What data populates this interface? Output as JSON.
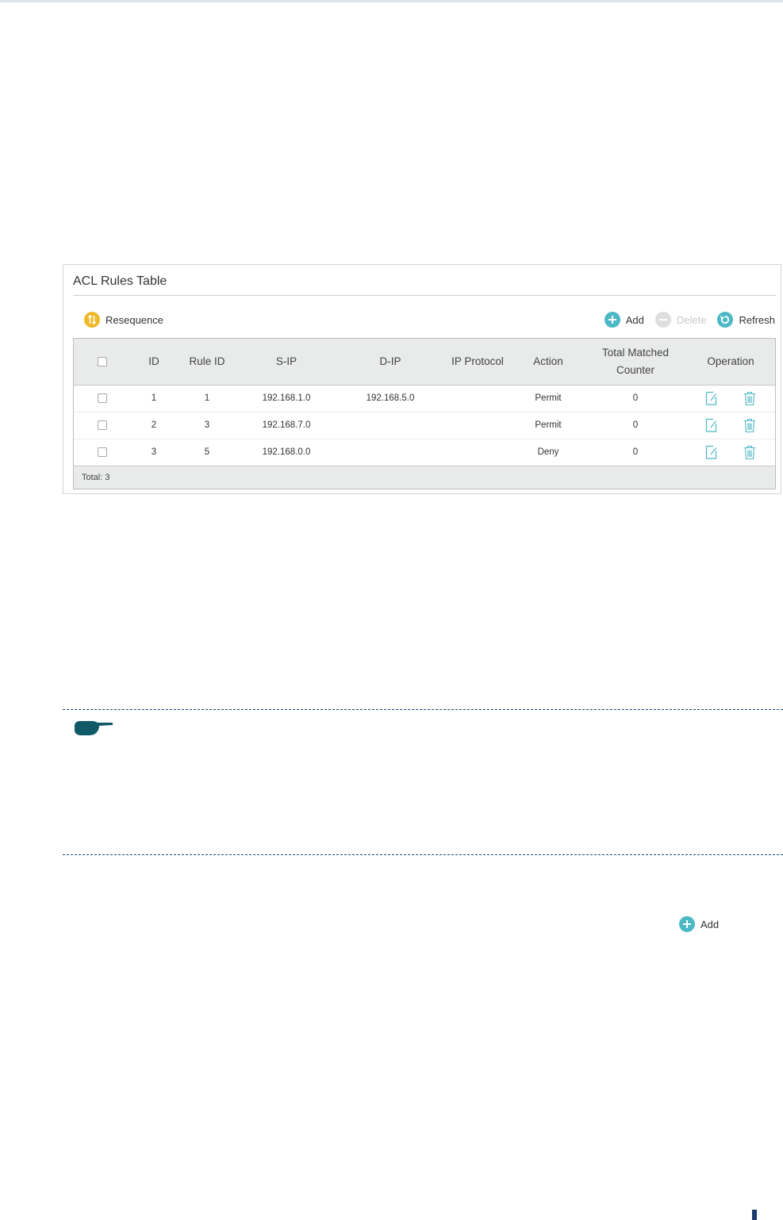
{
  "panel": {
    "title": "ACL Rules Table",
    "resequence_label": "Resequence",
    "add_label": "Add",
    "delete_label": "Delete",
    "refresh_label": "Refresh"
  },
  "table": {
    "headers": {
      "id": "ID",
      "rule_id": "Rule ID",
      "s_ip": "S-IP",
      "d_ip": "D-IP",
      "ip_protocol": "IP Protocol",
      "action": "Action",
      "total_matched_line1": "Total Matched",
      "total_matched_line2": "Counter",
      "operation": "Operation"
    },
    "rows": [
      {
        "id": "1",
        "rule_id": "1",
        "s_ip": "192.168.1.0",
        "d_ip": "192.168.5.0",
        "ip_protocol": "",
        "action": "Permit",
        "total": "0"
      },
      {
        "id": "2",
        "rule_id": "3",
        "s_ip": "192.168.7.0",
        "d_ip": "",
        "ip_protocol": "",
        "action": "Permit",
        "total": "0"
      },
      {
        "id": "3",
        "rule_id": "5",
        "s_ip": "192.168.0.0",
        "d_ip": "",
        "ip_protocol": "",
        "action": "Deny",
        "total": "0"
      }
    ],
    "footer": "Total: 3"
  },
  "bottom": {
    "add_label": "Add"
  },
  "colors": {
    "accent": "#4db8c5",
    "resequence": "#f0b928",
    "disabled": "#cfcfcf",
    "note_dash": "#1b4d7a",
    "pointer": "#0f5a66"
  },
  "icons": {
    "resequence": "resequence-icon",
    "add": "plus-circle-icon",
    "delete": "minus-circle-icon",
    "refresh": "refresh-icon",
    "edit": "edit-icon",
    "trash": "trash-icon",
    "note": "pointing-hand-icon"
  }
}
